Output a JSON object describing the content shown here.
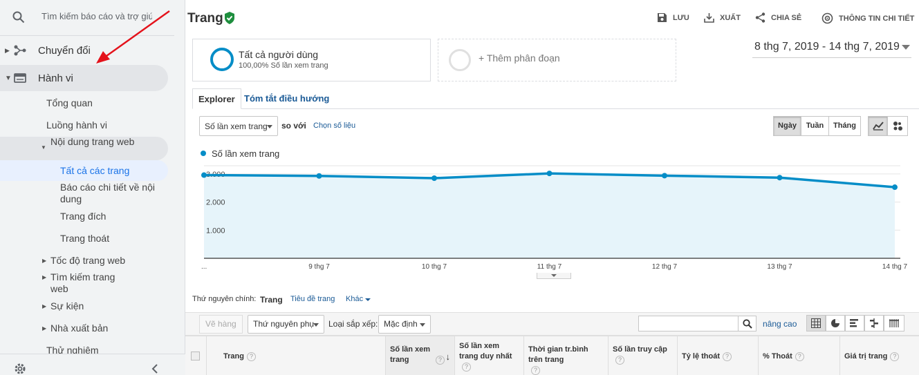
{
  "sidebar": {
    "search_placeholder": "Tìm kiếm báo cáo và trợ giú",
    "top_items": [
      {
        "label": "Chuyển đổi",
        "icon": "conversion-icon"
      },
      {
        "label": "Hành vi",
        "icon": "behavior-icon"
      }
    ],
    "sub_items": {
      "overview": "Tổng quan",
      "flow": "Luồng hành vi",
      "content": "Nội dung trang web",
      "all_pages": "Tất cả các trang",
      "drilldown": "Báo cáo chi tiết về nội dung",
      "landing": "Trang đích",
      "exit": "Trang thoát",
      "speed": "Tốc độ trang web",
      "search": "Tìm kiếm trang web",
      "events": "Sự kiện",
      "publisher": "Nhà xuất bản",
      "experiments": "Thử nghiệm"
    }
  },
  "header": {
    "title": "Trang",
    "actions": {
      "save": "LƯU",
      "export": "XUẤT",
      "share": "CHIA SẺ",
      "insights": "THÔNG TIN CHI TIẾT"
    }
  },
  "segments": {
    "active_title": "Tất cả người dùng",
    "active_sub": "100,00% Số lần xem trang",
    "add": "+ Thêm phân đoạn"
  },
  "date_range": "8 thg 7, 2019 - 14 thg 7, 2019",
  "tabs": {
    "explorer": "Explorer",
    "nav_summary": "Tóm tắt điều hướng"
  },
  "controls": {
    "metric": "Số lần xem trang",
    "vs": "so với",
    "choose_metric": "Chọn số liệu",
    "granularity": {
      "day": "Ngày",
      "week": "Tuần",
      "month": "Tháng"
    }
  },
  "chart_data": {
    "type": "line",
    "legend": "Số lần xem trang",
    "x": [
      "...",
      "9 thg 7",
      "10 thg 7",
      "11 thg 7",
      "12 thg 7",
      "13 thg 7",
      "14 thg 7"
    ],
    "series": [
      {
        "name": "Số lần xem trang",
        "values": [
          2960,
          2930,
          2850,
          3020,
          2940,
          2870,
          2530
        ],
        "color": "#058dc7"
      }
    ],
    "y_ticks": [
      "1.000",
      "2.000",
      "3.000"
    ],
    "ylim": [
      0,
      3000
    ],
    "grid": true,
    "area_fill": "#e6f4fa"
  },
  "dimension": {
    "label": "Thứ nguyên chính:",
    "options": [
      "Trang",
      "Tiêu đề trang",
      "Khác"
    ]
  },
  "table_toolbar": {
    "plot_rows": "Vẽ hàng",
    "secondary": "Thứ nguyên phụ",
    "sort_label": "Loại sắp xếp:",
    "sort_value": "Mặc định",
    "advanced": "nâng cao"
  },
  "table": {
    "columns": [
      "Trang",
      "Số lần xem trang",
      "Số lần xem trang duy nhất",
      "Thời gian tr.bình trên trang",
      "Số lần truy cập",
      "Tỷ lệ thoát",
      "% Thoát",
      "Giá trị trang"
    ]
  }
}
